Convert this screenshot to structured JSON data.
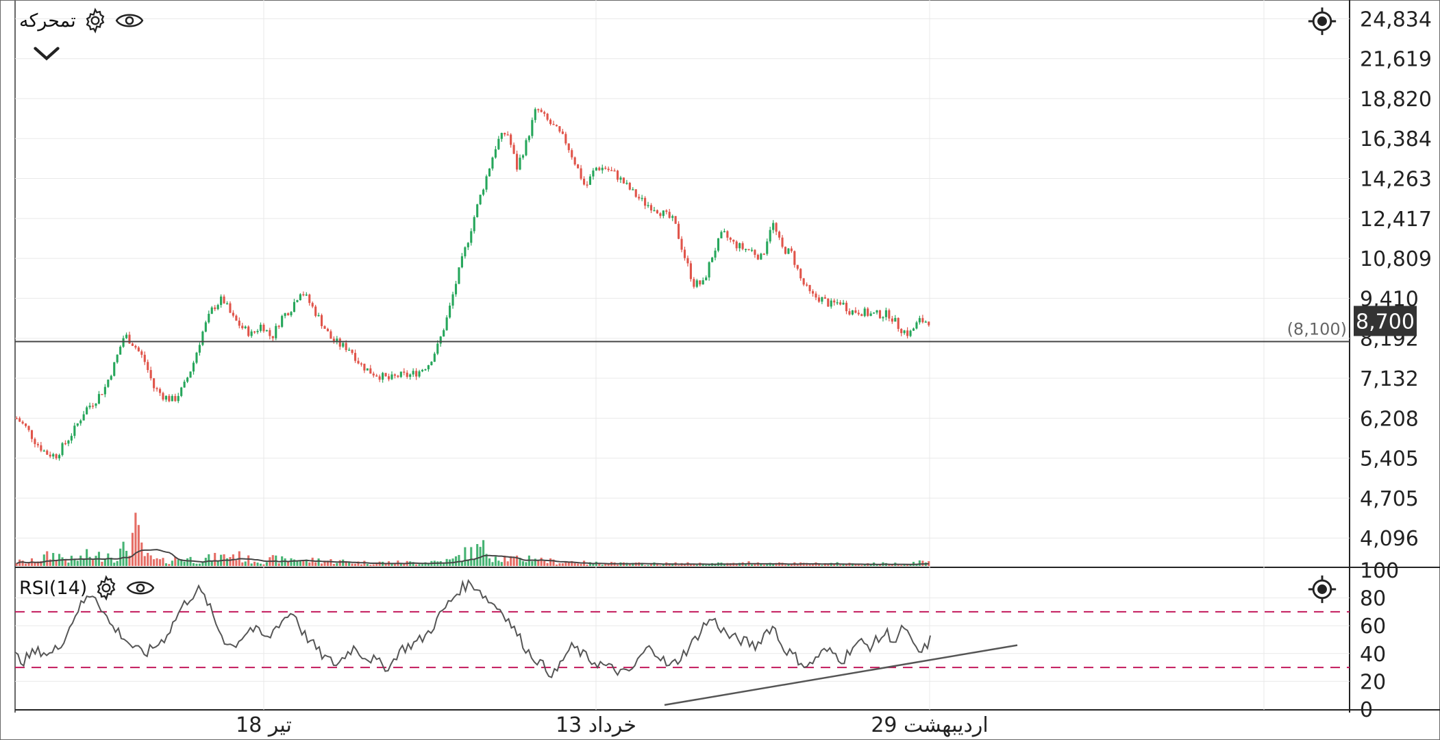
{
  "app": {
    "symbol": "تمحرکه",
    "indicator_label": "RSI(14)"
  },
  "icons": {
    "settings": "gear-icon",
    "visibility": "eye-icon",
    "collapse": "chevron-down-icon",
    "crosshair": "crosshair-target-icon"
  },
  "colors": {
    "up": "#26a65b",
    "down": "#e0544a",
    "line": "#555555",
    "grid": "#e9e9e9",
    "rsi_band": "#c2185b",
    "price_badge_bg": "#333333",
    "price_badge_text": "#ffffff"
  },
  "chart_data": [
    {
      "type": "candlestick",
      "y_scale": "log",
      "ylim": [
        3700,
        26500
      ],
      "y_ticks": [
        24834,
        21619,
        18820,
        16384,
        14263,
        12417,
        10809,
        9410,
        8192,
        7132,
        6208,
        5405,
        4705,
        4096
      ],
      "y_tick_labels": [
        "24,834",
        "21,619",
        "18,820",
        "16,384",
        "14,263",
        "12,417",
        "10,809",
        "9,410",
        "8,192",
        "7,132",
        "6,208",
        "5,405",
        "4,705",
        "4,096"
      ],
      "x_labels": [
        "18 تیر",
        "13 خرداد",
        "29 اردیبهشت"
      ],
      "last_price": 8700,
      "last_price_label": "8,700",
      "horizontal_line": {
        "value": 8100,
        "label": "(8,100)"
      },
      "close_series_approx": [
        6208,
        6000,
        5700,
        5500,
        5450,
        5700,
        6000,
        6400,
        6600,
        6900,
        7500,
        8300,
        8000,
        7600,
        6900,
        6700,
        6600,
        6900,
        7500,
        8400,
        9100,
        9400,
        8800,
        8500,
        8300,
        8600,
        8200,
        8800,
        9100,
        9700,
        9200,
        8700,
        8200,
        8000,
        7900,
        7500,
        7300,
        7200,
        7100,
        7200,
        7200,
        7300,
        7500,
        8000,
        8900,
        10200,
        11500,
        13000,
        14500,
        16200,
        16800,
        14800,
        16200,
        18200,
        17500,
        16900,
        16200,
        15000,
        13800,
        14800,
        14800,
        14500,
        14000,
        13500,
        13100,
        12900,
        12600,
        12300,
        11000,
        9900,
        9900,
        11000,
        11800,
        11400,
        11200,
        11100,
        10800,
        12300,
        11200,
        11000,
        10000,
        9500,
        9400,
        9200,
        9300,
        9000,
        9000,
        8900,
        8900,
        8900,
        8500,
        8300,
        8700,
        8700
      ],
      "volume_scale_label": "",
      "volume_series_approx": [
        0.04,
        0.03,
        0.05,
        0.08,
        0.1,
        0.06,
        0.05,
        0.09,
        0.07,
        0.12,
        0.08,
        0.15,
        0.3,
        0.08,
        0.05,
        0.04,
        0.06,
        0.07,
        0.05,
        0.06,
        0.07,
        0.08,
        0.1,
        0.06,
        0.05,
        0.04,
        0.06,
        0.05,
        0.07,
        0.04,
        0.05,
        0.05,
        0.04,
        0.04,
        0.03,
        0.03,
        0.03,
        0.03,
        0.03,
        0.03,
        0.03,
        0.03,
        0.04,
        0.04,
        0.05,
        0.1,
        0.12,
        0.15,
        0.1,
        0.08,
        0.06,
        0.05,
        0.08,
        0.05,
        0.04,
        0.03,
        0.04,
        0.03,
        0.02,
        0.03,
        0.03,
        0.02,
        0.02,
        0.02,
        0.02,
        0.02,
        0.02,
        0.02,
        0.02,
        0.02,
        0.02,
        0.02,
        0.02,
        0.02,
        0.03,
        0.03,
        0.02,
        0.03,
        0.02,
        0.02,
        0.02,
        0.02,
        0.02,
        0.02,
        0.02,
        0.02,
        0.02,
        0.02,
        0.02,
        0.02,
        0.02,
        0.04,
        0.03
      ]
    },
    {
      "type": "line",
      "title": "RSI(14)",
      "ylim": [
        0,
        100
      ],
      "y_ticks": [
        100,
        80,
        60,
        40,
        20,
        0
      ],
      "band_lines": [
        70,
        30
      ],
      "rsi_series_approx": [
        38,
        35,
        40,
        42,
        39,
        45,
        55,
        70,
        78,
        84,
        72,
        60,
        55,
        48,
        42,
        40,
        45,
        50,
        60,
        72,
        80,
        86,
        78,
        62,
        50,
        45,
        52,
        58,
        55,
        50,
        60,
        66,
        70,
        55,
        48,
        40,
        35,
        32,
        40,
        45,
        38,
        36,
        32,
        30,
        42,
        45,
        48,
        52,
        60,
        70,
        78,
        86,
        90,
        88,
        80,
        75,
        70,
        60,
        50,
        40,
        35,
        28,
        25,
        38,
        45,
        40,
        35,
        33,
        30,
        28,
        25,
        30,
        40,
        45,
        38,
        30,
        35,
        42,
        50,
        60,
        65,
        58,
        52,
        50,
        48,
        45,
        55,
        60,
        45,
        40,
        35,
        30,
        38,
        42,
        40,
        35,
        45,
        48,
        45,
        50,
        55,
        48,
        60,
        45,
        40,
        50
      ],
      "trendline": {
        "start_value": 3,
        "end_value": 46,
        "start_fraction": 0.46,
        "end_fraction": 0.72
      }
    }
  ]
}
